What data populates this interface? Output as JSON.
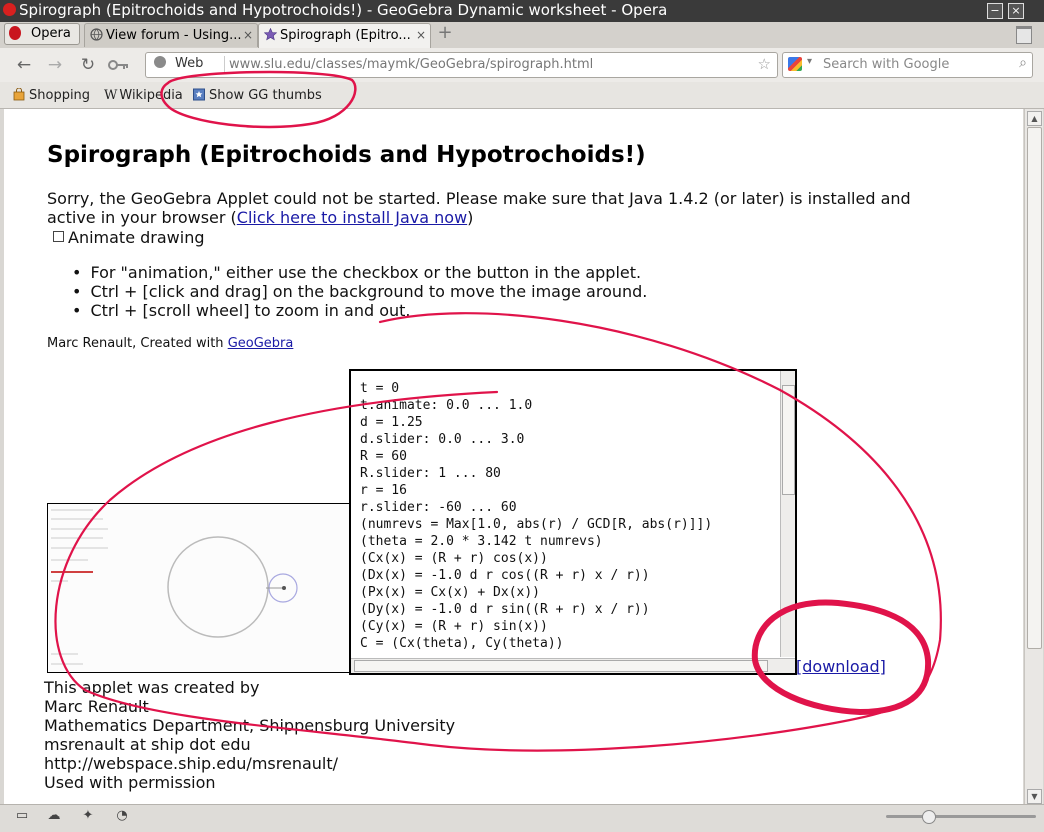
{
  "window": {
    "title": "Spirograph (Epitrochoids and Hypotrochoids!) - GeoGebra Dynamic worksheet - Opera",
    "minimize": "−",
    "close": "×"
  },
  "tabs": {
    "menu_label": "Opera",
    "items": [
      {
        "label": "View forum - Using..."
      },
      {
        "label": "Spirograph (Epitro..."
      }
    ],
    "close_glyph": "×",
    "add_glyph": "+"
  },
  "nav": {
    "back": "←",
    "forward": "→",
    "reload": "↻",
    "web_label": "Web",
    "url": "www.slu.edu/classes/maymk/GeoGebra/spirograph.html",
    "star": "☆",
    "search_placeholder": "Search with Google",
    "search_glyph": "⌕"
  },
  "bookmarks": [
    {
      "label": "Shopping"
    },
    {
      "label": "Wikipedia"
    },
    {
      "label": "Show GG thumbs"
    }
  ],
  "page": {
    "heading": "Spirograph (Epitrochoids and Hypotrochoids!)",
    "java_msg": "Sorry, the GeoGebra Applet could not be started. Please make sure that Java 1.4.2 (or later) is installed and active in your browser (",
    "java_link": "Click here to install Java now",
    "java_close": ")",
    "checkbox_label": "Animate drawing",
    "bullets": [
      "For \"animation,\" either use the checkbox or the button in the applet.",
      "Ctrl + [click and drag] on the background to move the image around.",
      "Ctrl + [scroll wheel] to zoom in and out."
    ],
    "credit_text": "Marc Renault, Created with ",
    "credit_link": "GeoGebra",
    "script_lines": [
      "t = 0",
      "t.animate: 0.0 ... 1.0",
      "d = 1.25",
      "d.slider: 0.0 ... 3.0",
      "R = 60",
      "R.slider: 1 ... 80",
      "r = 16",
      "r.slider: -60 ... 60",
      "(numrevs = Max[1.0, abs(r) / GCD[R, abs(r)]])",
      "(theta = 2.0 * 3.142 t numrevs)",
      "(Cx(x) = (R + r) cos(x))",
      "(Dx(x) = -1.0 d r cos((R + r) x / r))",
      "(Px(x) = Cx(x) + Dx(x))",
      "(Dy(x) = -1.0 d r sin((R + r) x / r))",
      "(Cy(x) = (R + r) sin(x))",
      "C = (Cx(theta), Cy(theta))"
    ],
    "download_label": "[download]",
    "credits": [
      "This applet was created by",
      "Marc Renault",
      "Mathematics Department, Shippensburg University",
      "msrenault at ship dot edu",
      "http://webspace.ship.edu/msrenault/",
      "Used with permission"
    ]
  },
  "colors": {
    "annotation": "#e0134a",
    "link": "#1a1aa6"
  }
}
